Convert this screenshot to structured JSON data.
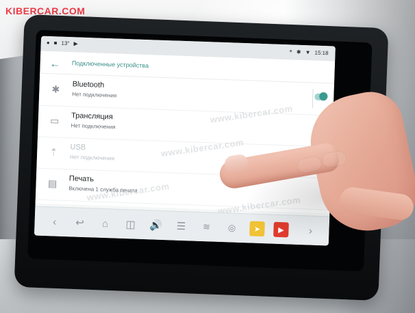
{
  "branding": {
    "logo_text": "KIBERCAR.COM"
  },
  "statusbar": {
    "left_items": [
      "13°",
      "▶"
    ],
    "time": "15:18"
  },
  "header": {
    "title": "Подключенные устройства"
  },
  "devices": [
    {
      "title": "Bluetooth",
      "subtitle": "Нет подключения",
      "icon": "bluetooth-icon"
    },
    {
      "title": "Трансляция",
      "subtitle": "Нет подключения",
      "icon": "cast-icon"
    },
    {
      "title": "USB",
      "subtitle": "Нет подключения",
      "icon": "usb-icon"
    },
    {
      "title": "Печать",
      "subtitle": "Включена 1 служба печати",
      "icon": "printer-icon"
    }
  ],
  "watermarks": [
    "www.kibercar.com",
    "www.kibercar.com",
    "www.kibercar.com",
    "www.kibercar.com"
  ],
  "navbar": {
    "icons": [
      "chevron-left-icon",
      "back-icon",
      "home-icon",
      "recent-apps-icon",
      "volume-icon",
      "menu-icon",
      "wifi-icon",
      "fingerprint-icon",
      "navigation-app-icon",
      "youtube-icon",
      "chevron-right-icon"
    ]
  },
  "colors": {
    "accent": "#3a9a8f",
    "logo": "#ed3c47"
  }
}
